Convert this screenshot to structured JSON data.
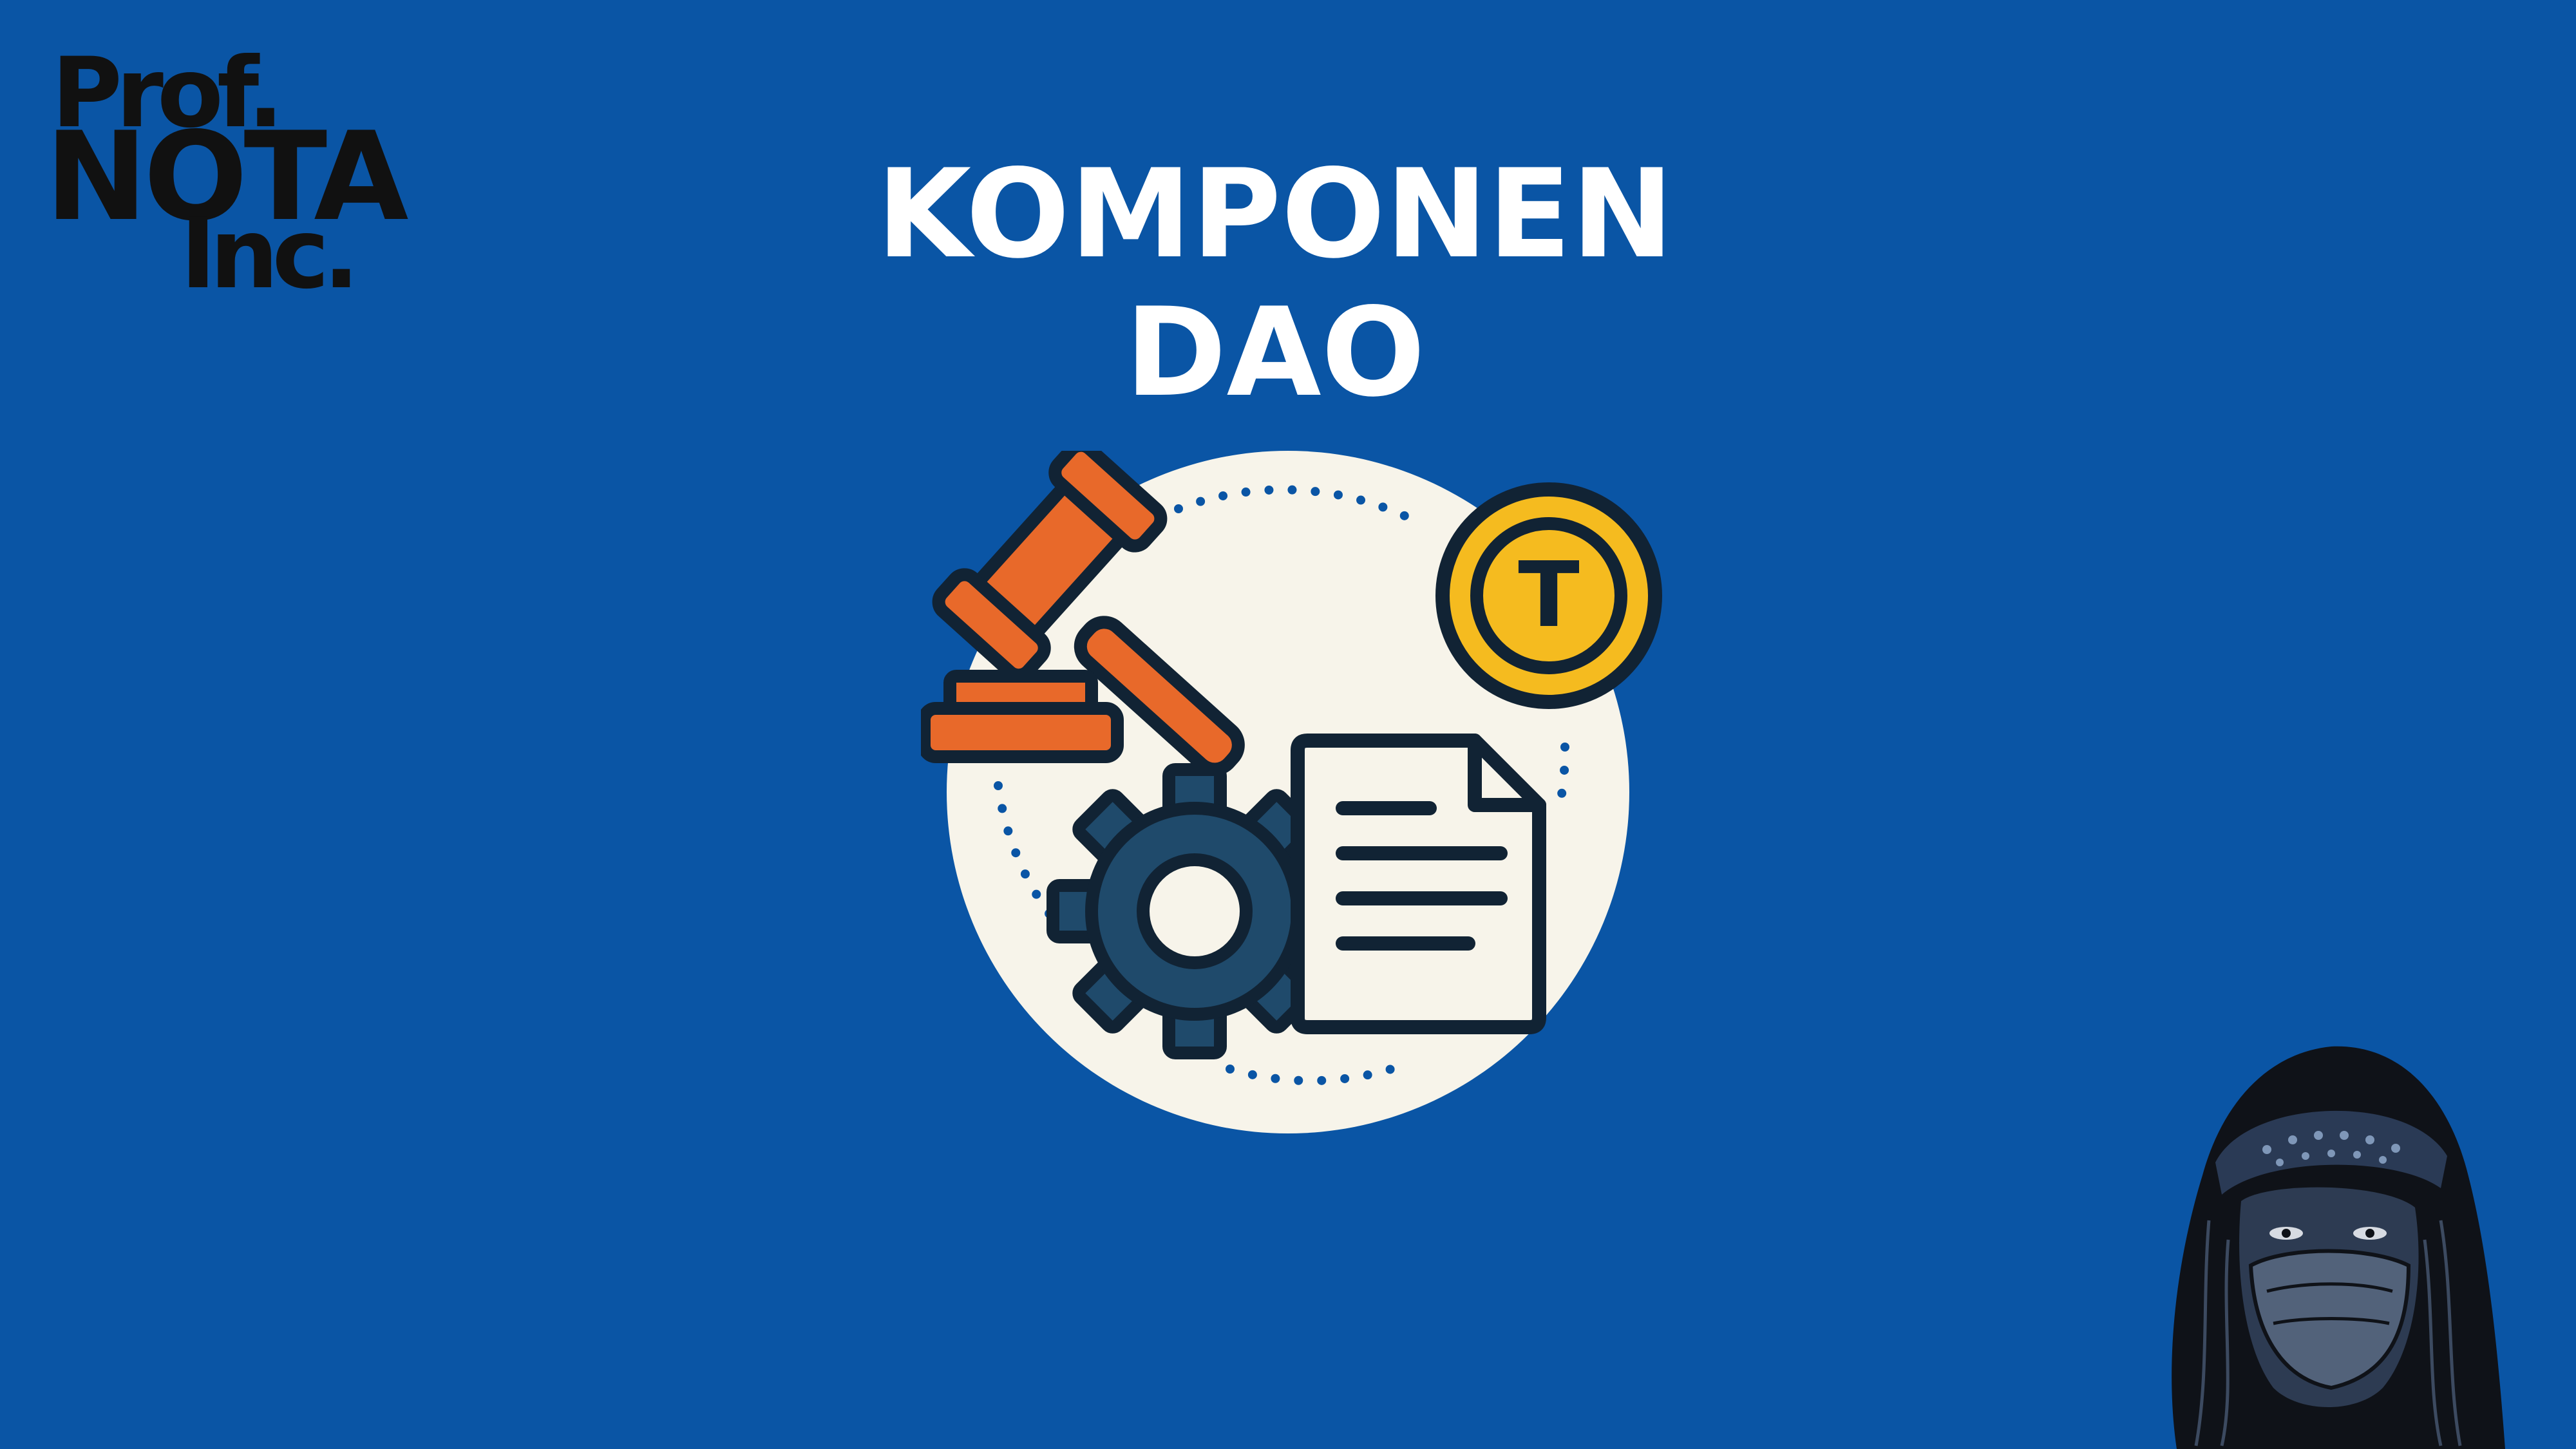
{
  "logo": {
    "line1": "Prof.",
    "line2": "NOTA",
    "line3": "Inc."
  },
  "title": {
    "line1": "KOMPONEN",
    "line2": "DAO"
  },
  "illustration": {
    "coin_letter": "T",
    "icons": [
      "gavel-icon",
      "coin-icon",
      "gear-icon",
      "document-icon"
    ]
  },
  "colors": {
    "background": "#0a55a5",
    "circle": "#f7f4ea",
    "gavel": "#e8692a",
    "coin": "#f5bb1f",
    "gear": "#1f4a6b",
    "outline": "#112334",
    "title": "#ffffff"
  }
}
